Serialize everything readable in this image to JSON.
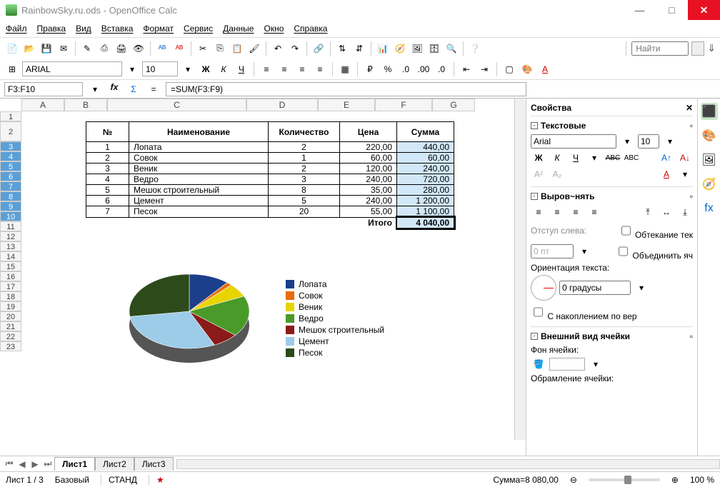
{
  "window": {
    "title": "RainbowSky.ru.ods - OpenOffice Calc",
    "minimize": "—",
    "maximize": "□",
    "close": "✕"
  },
  "menu": [
    "Файл",
    "Правка",
    "Вид",
    "Вставка",
    "Формат",
    "Сервис",
    "Данные",
    "Окно",
    "Справка"
  ],
  "find_placeholder": "Найти",
  "format": {
    "font": "ARIAL",
    "size": "10",
    "bold": "Ж",
    "italic": "К",
    "underline": "Ч"
  },
  "formula": {
    "name_box": "F3:F10",
    "value": "=SUM(F3:F9)"
  },
  "columns": [
    {
      "label": "A",
      "w": 60
    },
    {
      "label": "B",
      "w": 60
    },
    {
      "label": "C",
      "w": 195
    },
    {
      "label": "D",
      "w": 100
    },
    {
      "label": "E",
      "w": 80
    },
    {
      "label": "F",
      "w": 80
    },
    {
      "label": "G",
      "w": 60
    }
  ],
  "table": {
    "headers": [
      "№",
      "Наименование",
      "Количество",
      "Цена",
      "Сумма"
    ],
    "rows": [
      [
        "1",
        "Лопата",
        "2",
        "220,00",
        "440,00"
      ],
      [
        "2",
        "Совок",
        "1",
        "60,00",
        "60,00"
      ],
      [
        "3",
        "Веник",
        "2",
        "120,00",
        "240,00"
      ],
      [
        "4",
        "Ведро",
        "3",
        "240,00",
        "720,00"
      ],
      [
        "5",
        "Мешок строительный",
        "8",
        "35,00",
        "280,00"
      ],
      [
        "6",
        "Цемент",
        "5",
        "240,00",
        "1 200,00"
      ],
      [
        "7",
        "Песок",
        "20",
        "55,00",
        "1 100,00"
      ]
    ],
    "total_label": "Итого",
    "total_value": "4 040,00"
  },
  "chart_data": {
    "type": "pie",
    "legend_position": "right",
    "series": [
      {
        "name": "Лопата",
        "value": 440,
        "color": "#1b3f8b"
      },
      {
        "name": "Совок",
        "value": 60,
        "color": "#e86c0a"
      },
      {
        "name": "Веник",
        "value": 240,
        "color": "#e8d400"
      },
      {
        "name": "Ведро",
        "value": 720,
        "color": "#4a9a2a"
      },
      {
        "name": "Мешок строительный",
        "value": 280,
        "color": "#8b1a1a"
      },
      {
        "name": "Цемент",
        "value": 1200,
        "color": "#9dcce8"
      },
      {
        "name": "Песок",
        "value": 1100,
        "color": "#2c4a1a"
      }
    ]
  },
  "tabs": [
    "Лист1",
    "Лист2",
    "Лист3"
  ],
  "active_tab": 0,
  "sidebar": {
    "title": "Свойства",
    "text_section": "Текстовые",
    "font": "Arial",
    "size": "10",
    "align_section": "Выров~нять",
    "indent_label": "Отступ слева:",
    "indent_value": "0 пт",
    "wrap_label": "Обтекание тек",
    "merge_label": "Объединить яч",
    "orient_label": "Ориентация текста:",
    "orient_value": "0 градусы",
    "stack_label": "С накоплением по вер",
    "cell_section": "Внешний вид ячейки",
    "bg_label": "Фон ячейки:",
    "border_label": "Обрамление ячейки:"
  },
  "statusbar": {
    "sheet": "Лист 1 / 3",
    "style": "Базовый",
    "mode": "СТАНД",
    "sum": "Сумма=8 080,00",
    "zoom": "100 %"
  }
}
